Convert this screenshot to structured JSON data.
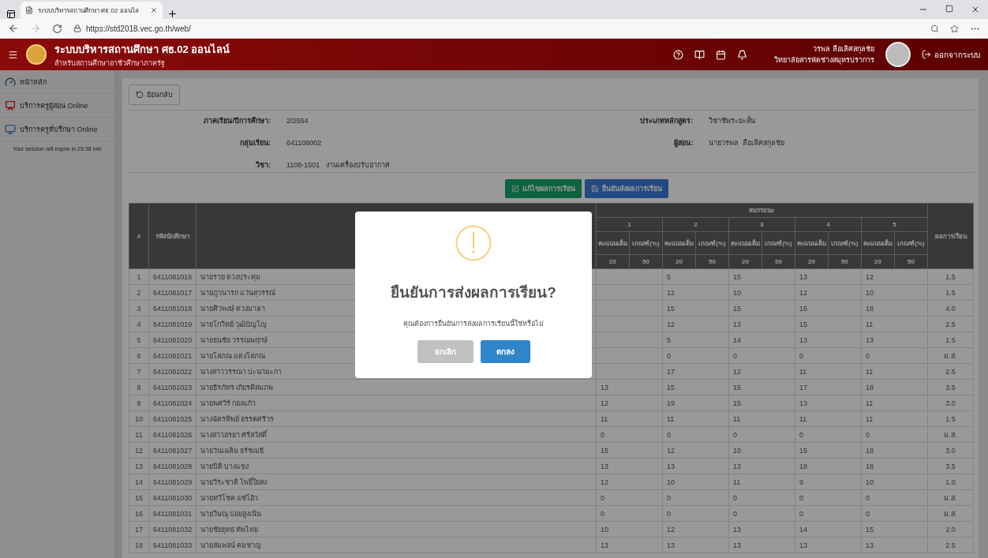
{
  "browser": {
    "tab_title": "ระบบบริหารสถานศึกษา ศธ.02 ออนไล",
    "url": "https://std2018.vec.go.th/web/"
  },
  "header": {
    "title": "ระบบบริหารสถานศึกษา ศธ.02 ออนไลน์",
    "subtitle": "สำหรับสถานศึกษาอาชีวศึกษาภาครัฐ",
    "user_name": "วรพล ลือเลิศสกุลชัย",
    "user_org": "วิทยาลัยสารพัดช่างสมุทรปราการ",
    "logout": "ออกจากระบบ"
  },
  "sidebar": {
    "items": [
      {
        "label": "หน้าหลัก",
        "kind": "home"
      },
      {
        "label": "บริการครูผู้สอน Online",
        "kind": "teacher"
      },
      {
        "label": "บริการครูที่ปรึกษา Online",
        "kind": "advisor"
      }
    ],
    "session": "Your session will expire in 29:38 min"
  },
  "back_button": "ย้อนกลับ",
  "info_left": [
    {
      "label": "ภาคเรียน/ปีการศึกษา:",
      "value": "2/2564"
    },
    {
      "label": "กลุ่มเรียน:",
      "value": "641108002"
    },
    {
      "label": "วิชา:",
      "value": "1108-1501   งานเครื่องปรับอากาศ"
    }
  ],
  "info_right": [
    {
      "label": "ประเภทหลักสูตร:",
      "value": "วิชาชีพระยะสั้น"
    },
    {
      "label": "ผู้สอน:",
      "value": "นายวรพล  ลือเลิศสกุลชัย"
    }
  ],
  "actions": [
    {
      "label": "แก้ไขผลการเรียน",
      "kind": "edit"
    },
    {
      "label": "ยืนยันส่งผลการเรียน",
      "kind": "save"
    }
  ],
  "table": {
    "col_no": "#",
    "col_code": "รหัสนักศึกษา",
    "group": "สมรรถนะ",
    "col_result": "ผลการเรียน",
    "competencies": [
      {
        "label": "1",
        "full_label": "คะแนนเต็ม",
        "criteria_label": "เกณฑ์(%)",
        "full": "20",
        "criteria": "50"
      },
      {
        "label": "2",
        "full_label": "คะแนนเต็ม",
        "criteria_label": "เกณฑ์(%)",
        "full": "20",
        "criteria": "50"
      },
      {
        "label": "3",
        "full_label": "คะแนนเต็ม",
        "criteria_label": "เกณฑ์(%)",
        "full": "20",
        "criteria": "50"
      },
      {
        "label": "4",
        "full_label": "คะแนนเต็ม",
        "criteria_label": "เกณฑ์(%)",
        "full": "20",
        "criteria": "50"
      },
      {
        "label": "5",
        "full_label": "คะแนนเต็ม",
        "criteria_label": "เกณฑ์(%)",
        "full": "20",
        "criteria": "50"
      }
    ],
    "rows": [
      {
        "no": "1",
        "code": "6411081016",
        "name": "นายรวย  ดวงประทุม",
        "scores": [
          "5",
          "15",
          "13",
          "12"
        ],
        "result": "1.5"
      },
      {
        "no": "2",
        "code": "6411081017",
        "name": "นายภูวนารถ  แว่นสุวรรณ์",
        "scores": [
          "12",
          "10",
          "12",
          "10"
        ],
        "result": "1.5"
      },
      {
        "no": "3",
        "code": "6411081018",
        "name": "นายศิวพงษ์  ดวงมาลา",
        "scores": [
          "15",
          "15",
          "16",
          "18"
        ],
        "result": "4.0"
      },
      {
        "no": "4",
        "code": "6411081019",
        "name": "นายโกวิทย์  วุฒิปัญโญ",
        "scores": [
          "12",
          "13",
          "15",
          "11"
        ],
        "result": "2.5"
      },
      {
        "no": "5",
        "code": "6411081020",
        "name": "นายธนชัย  วรรณพฤกษ์",
        "scores": [
          "5",
          "14",
          "13",
          "13"
        ],
        "result": "1.5"
      },
      {
        "no": "6",
        "code": "6411081021",
        "name": "นายโสภณ  แดงโสภณ",
        "scores": [
          "0",
          "0",
          "0",
          "0"
        ],
        "result": "ม.ส."
      },
      {
        "no": "7",
        "code": "6411081022",
        "name": "นางสาววรรณา  ปะนามะกา",
        "scores": [
          "17",
          "12",
          "11",
          "11"
        ],
        "result": "2.5"
      },
      {
        "no": "8",
        "code": "6411081023",
        "name": "นายธีรภัทร  เกียรติสมภพ",
        "scores": [
          "13",
          "15",
          "15",
          "17",
          "18"
        ],
        "result": "3.5"
      },
      {
        "no": "9",
        "code": "6411081024",
        "name": "นายพศวีร์  กองแก้ว",
        "scores": [
          "12",
          "19",
          "15",
          "13",
          "11"
        ],
        "result": "3.0"
      },
      {
        "no": "10",
        "code": "6411081025",
        "name": "นางฉัตรทิพย์  อรรคศรีวร",
        "scores": [
          "11",
          "11",
          "11",
          "11",
          "11"
        ],
        "result": "1.5"
      },
      {
        "no": "11",
        "code": "6411081026",
        "name": "นางสาวอรยา  ศรีสวัสดิ์",
        "scores": [
          "0",
          "0",
          "0",
          "0",
          "0"
        ],
        "result": "ม.ส."
      },
      {
        "no": "12",
        "code": "6411081027",
        "name": "นายวันเฉลิม  ธรัชเมธี",
        "scores": [
          "15",
          "12",
          "10",
          "15",
          "18"
        ],
        "result": "3.0"
      },
      {
        "no": "13",
        "code": "6411081028",
        "name": "นายปิติ  บางแข่ง",
        "scores": [
          "13",
          "13",
          "13",
          "18",
          "18"
        ],
        "result": "3.5"
      },
      {
        "no": "14",
        "code": "6411081029",
        "name": "นายวีระชาติ  โพธิ์ใยสง",
        "scores": [
          "12",
          "10",
          "11",
          "9",
          "10"
        ],
        "result": "1.0"
      },
      {
        "no": "15",
        "code": "6411081030",
        "name": "นายทวีโชค  แซ่โอ้ว",
        "scores": [
          "0",
          "0",
          "0",
          "0",
          "0"
        ],
        "result": "ม.ส."
      },
      {
        "no": "16",
        "code": "6411081031",
        "name": "นายวิษณุ  ปอยสูงเนิน",
        "scores": [
          "0",
          "0",
          "0",
          "0",
          "0"
        ],
        "result": "ม.ส."
      },
      {
        "no": "17",
        "code": "6411081032",
        "name": "นายชัยยุทธ  ทัพไทย",
        "scores": [
          "10",
          "12",
          "13",
          "14",
          "15"
        ],
        "result": "2.0"
      },
      {
        "no": "18",
        "code": "6411081033",
        "name": "นายสมพจน์  คมชาญ",
        "scores": [
          "13",
          "13",
          "13",
          "13",
          "13"
        ],
        "result": "2.5"
      }
    ]
  },
  "dialog": {
    "title": "ยืนยันการส่งผลการเรียน?",
    "message": "คุณต้องการยืนยันการส่งผลการเรียนนี้ใช่หรือไม่",
    "cancel": "ยกเลิก",
    "confirm": "ตกลง"
  }
}
